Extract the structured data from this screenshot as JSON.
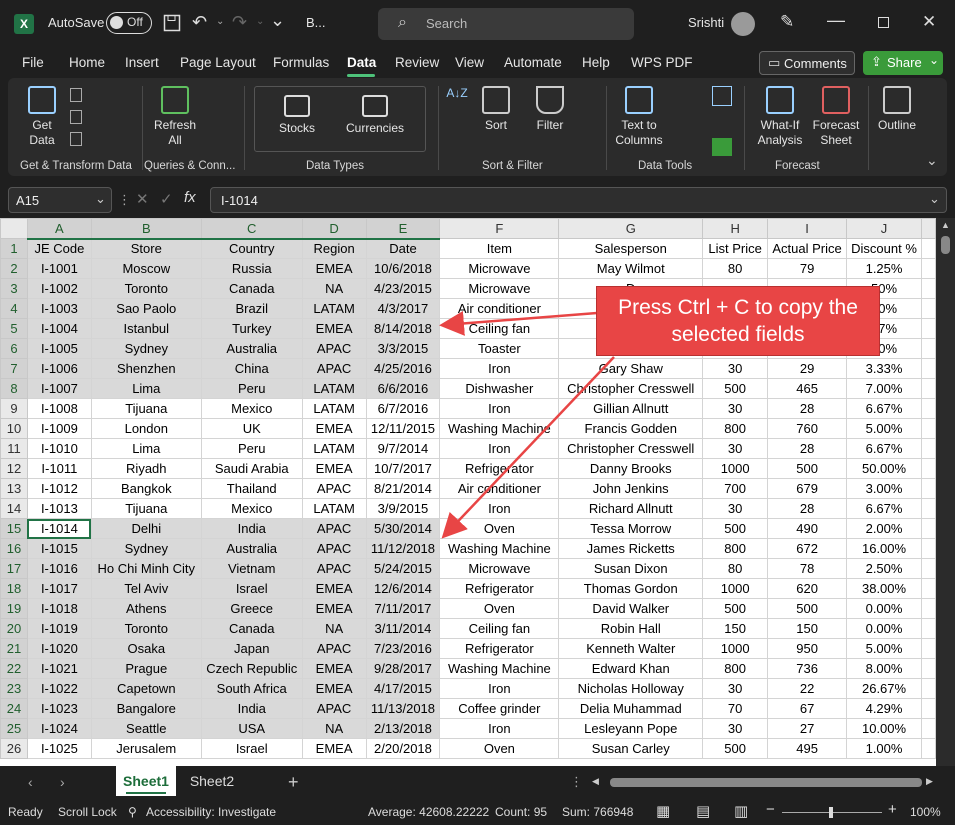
{
  "titlebar": {
    "autosave_label": "AutoSave",
    "autosave_state": "Off",
    "file_name": "B...",
    "search_placeholder": "Search",
    "user_name": "Srishti"
  },
  "menu": [
    "File",
    "Home",
    "Insert",
    "Page Layout",
    "Formulas",
    "Data",
    "Review",
    "View",
    "Automate",
    "Help",
    "WPS PDF"
  ],
  "menu_active": "Data",
  "comments_label": "Comments",
  "share_label": "Share",
  "ribbon": {
    "get_data": "Get Data",
    "refresh_all": "Refresh All",
    "stocks": "Stocks",
    "currencies": "Currencies",
    "sort": "Sort",
    "filter": "Filter",
    "text_to_columns": "Text to Columns",
    "what_if": "What-If Analysis",
    "forecast_sheet": "Forecast Sheet",
    "outline": "Outline",
    "groups": [
      "Get & Transform Data",
      "Queries & Conn...",
      "Data Types",
      "Sort & Filter",
      "Data Tools",
      "Forecast"
    ]
  },
  "name_box": "A15",
  "formula_value": "I-1014",
  "columns": [
    "A",
    "B",
    "C",
    "D",
    "E",
    "F",
    "G",
    "H",
    "I",
    "J"
  ],
  "rows": [
    [
      "JE Code",
      "Store",
      "Country",
      "Region",
      "Date",
      "Item",
      "Salesperson",
      "List Price",
      "Actual Price",
      "Discount %"
    ],
    [
      "I-1001",
      "Moscow",
      "Russia",
      "EMEA",
      "10/6/2018",
      "Microwave",
      "May Wilmot",
      "80",
      "79",
      "1.25%"
    ],
    [
      "I-1002",
      "Toronto",
      "Canada",
      "NA",
      "4/23/2015",
      "Microwave",
      "D",
      "",
      "",
      "50%"
    ],
    [
      "I-1003",
      "Sao Paolo",
      "Brazil",
      "LATAM",
      "4/3/2017",
      "Air conditioner",
      "G",
      "",
      "",
      "00%"
    ],
    [
      "I-1004",
      "Istanbul",
      "Turkey",
      "EMEA",
      "8/14/2018",
      "Ceiling fan",
      "M",
      "",
      "",
      "67%"
    ],
    [
      "I-1005",
      "Sydney",
      "Australia",
      "APAC",
      "3/3/2015",
      "Toaster",
      "Ch",
      "",
      "",
      "00%"
    ],
    [
      "I-1006",
      "Shenzhen",
      "China",
      "APAC",
      "4/25/2016",
      "Iron",
      "Gary Shaw",
      "30",
      "29",
      "3.33%"
    ],
    [
      "I-1007",
      "Lima",
      "Peru",
      "LATAM",
      "6/6/2016",
      "Dishwasher",
      "Christopher Cresswell",
      "500",
      "465",
      "7.00%"
    ],
    [
      "I-1008",
      "Tijuana",
      "Mexico",
      "LATAM",
      "6/7/2016",
      "Iron",
      "Gillian Allnutt",
      "30",
      "28",
      "6.67%"
    ],
    [
      "I-1009",
      "London",
      "UK",
      "EMEA",
      "12/11/2015",
      "Washing Machine",
      "Francis Godden",
      "800",
      "760",
      "5.00%"
    ],
    [
      "I-1010",
      "Lima",
      "Peru",
      "LATAM",
      "9/7/2014",
      "Iron",
      "Christopher Cresswell",
      "30",
      "28",
      "6.67%"
    ],
    [
      "I-1011",
      "Riyadh",
      "Saudi Arabia",
      "EMEA",
      "10/7/2017",
      "Refrigerator",
      "Danny Brooks",
      "1000",
      "500",
      "50.00%"
    ],
    [
      "I-1012",
      "Bangkok",
      "Thailand",
      "APAC",
      "8/21/2014",
      "Air conditioner",
      "John Jenkins",
      "700",
      "679",
      "3.00%"
    ],
    [
      "I-1013",
      "Tijuana",
      "Mexico",
      "LATAM",
      "3/9/2015",
      "Iron",
      "Richard Allnutt",
      "30",
      "28",
      "6.67%"
    ],
    [
      "I-1014",
      "Delhi",
      "India",
      "APAC",
      "5/30/2014",
      "Oven",
      "Tessa Morrow",
      "500",
      "490",
      "2.00%"
    ],
    [
      "I-1015",
      "Sydney",
      "Australia",
      "APAC",
      "11/12/2018",
      "Washing Machine",
      "James Ricketts",
      "800",
      "672",
      "16.00%"
    ],
    [
      "I-1016",
      "Ho Chi Minh City",
      "Vietnam",
      "APAC",
      "5/24/2015",
      "Microwave",
      "Susan Dixon",
      "80",
      "78",
      "2.50%"
    ],
    [
      "I-1017",
      "Tel Aviv",
      "Israel",
      "EMEA",
      "12/6/2014",
      "Refrigerator",
      "Thomas Gordon",
      "1000",
      "620",
      "38.00%"
    ],
    [
      "I-1018",
      "Athens",
      "Greece",
      "EMEA",
      "7/11/2017",
      "Oven",
      "David Walker",
      "500",
      "500",
      "0.00%"
    ],
    [
      "I-1019",
      "Toronto",
      "Canada",
      "NA",
      "3/11/2014",
      "Ceiling fan",
      "Robin Hall",
      "150",
      "150",
      "0.00%"
    ],
    [
      "I-1020",
      "Osaka",
      "Japan",
      "APAC",
      "7/23/2016",
      "Refrigerator",
      "Kenneth Walter",
      "1000",
      "950",
      "5.00%"
    ],
    [
      "I-1021",
      "Prague",
      "Czech Republic",
      "EMEA",
      "9/28/2017",
      "Washing Machine",
      "Edward Khan",
      "800",
      "736",
      "8.00%"
    ],
    [
      "I-1022",
      "Capetown",
      "South Africa",
      "EMEA",
      "4/17/2015",
      "Iron",
      "Nicholas Holloway",
      "30",
      "22",
      "26.67%"
    ],
    [
      "I-1023",
      "Bangalore",
      "India",
      "APAC",
      "11/13/2018",
      "Coffee grinder",
      "Delia Muhammad",
      "70",
      "67",
      "4.29%"
    ],
    [
      "I-1024",
      "Seattle",
      "USA",
      "NA",
      "2/13/2018",
      "Iron",
      "Lesleyann Pope",
      "30",
      "27",
      "10.00%"
    ],
    [
      "I-1025",
      "Jerusalem",
      "Israel",
      "EMEA",
      "2/20/2018",
      "Oven",
      "Susan Carley",
      "500",
      "495",
      "1.00%"
    ]
  ],
  "callout": "Press Ctrl + C to copy the selected fields",
  "sheets": [
    "Sheet1",
    "Sheet2"
  ],
  "status": {
    "ready": "Ready",
    "scroll_lock": "Scroll Lock",
    "accessibility": "Accessibility: Investigate",
    "average": "Average: 42608.22222",
    "count": "Count: 95",
    "sum": "Sum: 766948",
    "zoom": "100%"
  },
  "colors": {
    "excel_green": "#217346",
    "share_green": "#3a9b3a",
    "callout_red": "#e84545",
    "selection_gray": "#d9d9d9"
  }
}
